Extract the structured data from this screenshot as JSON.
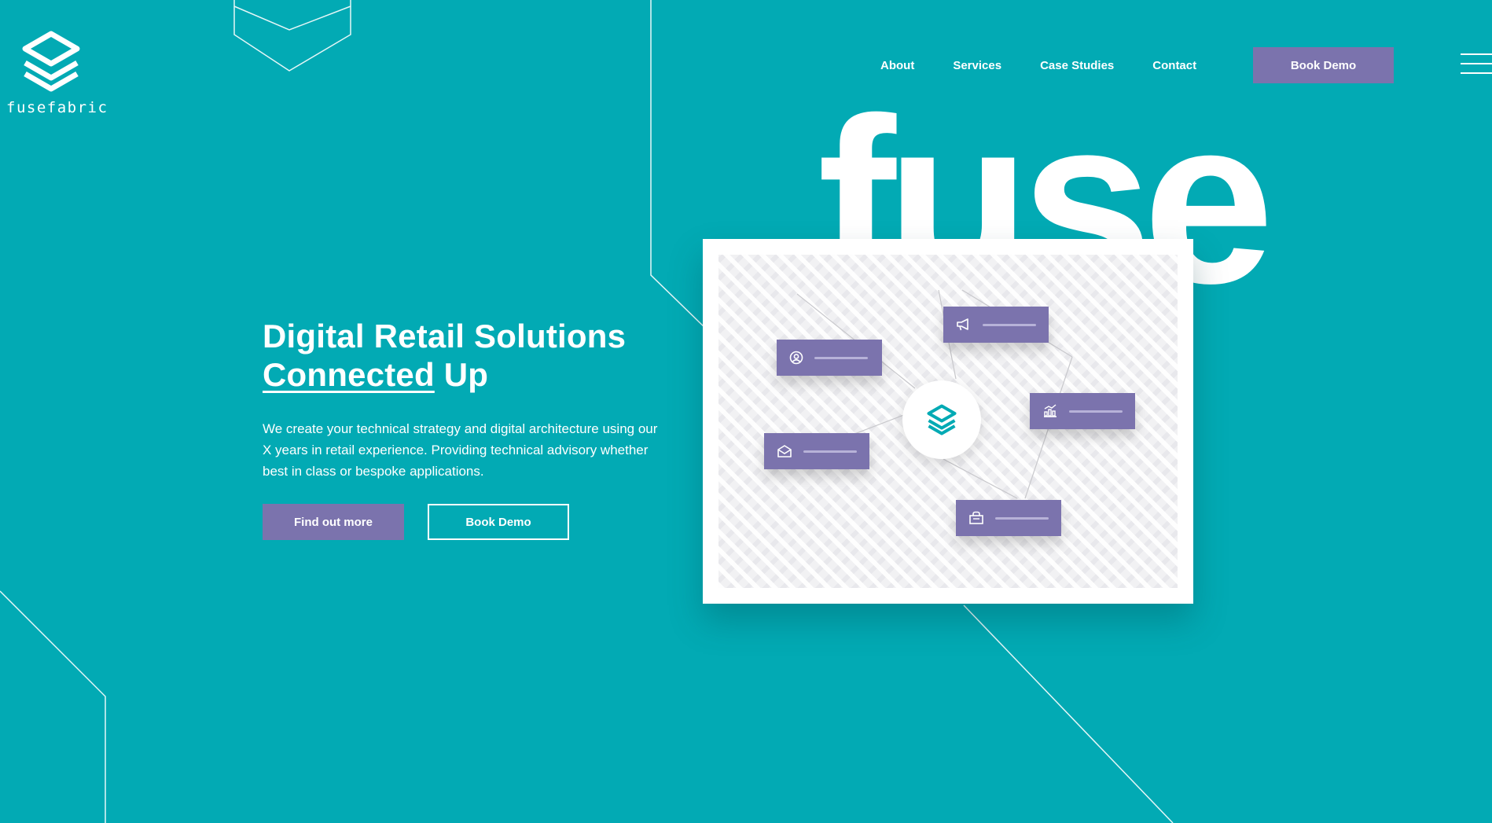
{
  "brand": {
    "name": "fusefabric",
    "colors": {
      "background": "#02aab4",
      "accent": "#7b73ad",
      "white": "#ffffff"
    },
    "logo_icon": "fusefabric-logo-icon"
  },
  "nav": {
    "links": [
      "About",
      "Services",
      "Case Studies",
      "Contact"
    ],
    "cta_label": "Book Demo",
    "menu_icon": "hamburger-menu-icon"
  },
  "hero": {
    "title_line1": "Digital Retail Solutions",
    "title_underlined": "Connected",
    "title_rest": " Up",
    "description": "We create your technical strategy and digital architecture using our X years in retail experience. Providing technical advisory whether best in class or bespoke applications.",
    "primary_button": "Find out more",
    "secondary_button": "Book Demo"
  },
  "illustration": {
    "big_word": "fuse",
    "center_icon": "fusefabric-logo-icon",
    "nodes": [
      {
        "icon": "user-icon"
      },
      {
        "icon": "megaphone-icon"
      },
      {
        "icon": "chart-icon"
      },
      {
        "icon": "mail-icon"
      },
      {
        "icon": "shopping-bag-icon"
      }
    ]
  }
}
